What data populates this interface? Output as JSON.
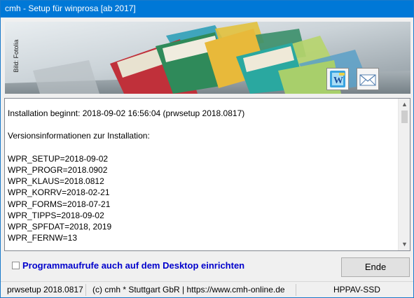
{
  "window": {
    "title": "cmh - Setup für winprosa [ab 2017]"
  },
  "banner": {
    "credit": "Bild: Fotolia"
  },
  "buttons": {
    "word_icon": "word-icon",
    "mail_icon": "mail-icon",
    "end_label": "Ende"
  },
  "log": {
    "lines": [
      "Installation beginnt: 2018-09-02 16:56:04 (prwsetup 2018.0817)",
      "",
      "Versionsinformationen zur Installation:",
      "",
      "WPR_SETUP=2018-09-02",
      "WPR_PROGR=2018.0902",
      "WPR_KLAUS=2018.0812",
      "WPR_KORRV=2018-02-21",
      "WPR_FORMS=2018-07-21",
      "WPR_TIPPS=2018-09-02",
      "WPR_SPFDAT=2018, 2019",
      "WPR_FERNW=13"
    ]
  },
  "option": {
    "label": "Programmaufrufe auch auf dem Desktop einrichten",
    "checked": false
  },
  "status": {
    "version": "prwsetup 2018.0817",
    "company": "(c) cmh * Stuttgart GbR | https://www.cmh-online.de",
    "machine": "HPPAV-SSD"
  },
  "colors": {
    "titlebar": "#0078d7",
    "option_text": "#0000cc"
  }
}
